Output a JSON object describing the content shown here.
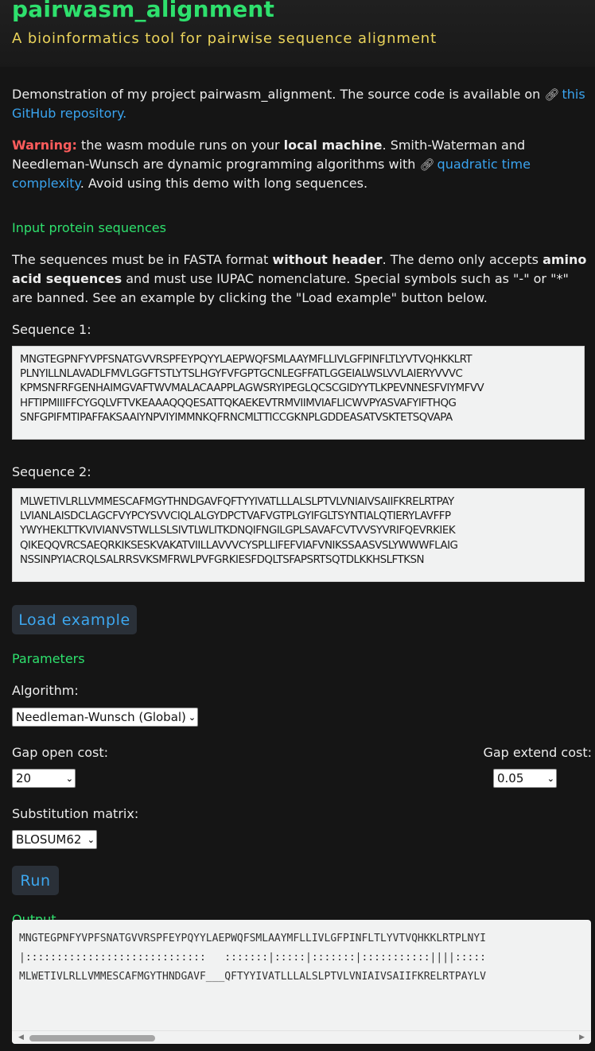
{
  "header": {
    "title": "pairwasm_alignment",
    "subtitle": "A bioinformatics tool for pairwise sequence alignment"
  },
  "intro": {
    "text": "Demonstration of my project pairwasm_alignment. The source code is available on ",
    "link_text": "this GitHub repository."
  },
  "warning": {
    "label": "Warning:",
    "text_1": " the wasm module runs on your ",
    "bold": "local machine",
    "text_2": ". Smith-Waterman and Needleman-Wunsch are dynamic programming algorithms with ",
    "link_text": "quadratic time complexity",
    "text_3": ". Avoid using this demo with long sequences."
  },
  "input_section": {
    "heading": "Input protein sequences",
    "desc_1": "The sequences must be in FASTA format ",
    "desc_bold_1": "without header",
    "desc_2": ". The demo only accepts ",
    "desc_bold_2": "amino acid sequences",
    "desc_3": " and must use IUPAC nomenclature. Special symbols such as \"-\" or \"*\" are banned. See an example by clicking the \"Load example\" button below.",
    "seq1_label": "Sequence 1:",
    "seq1_lines": [
      "MNGTEGPNFYVPFSNATGVVRSPFEYPQYYLAEPWQFSMLAAYMFLLIVLGFPINFLTLYVTVQHKKLRT",
      "PLNYILLNLAVADLFMVLGGFTSTLYTSLHGYFVFGPTGCNLEGFFATLGGEIALWSLVVLAIERYVVVC",
      "KPMSNFRFGENHAIMGVAFTWVMALACAAPPLAGWSRYIPEGLQCSCGIDYYTLKPEVNNESFVIYMFVV",
      "HFTIPMIIIFFCYGQLVFTVKEAAAQQQESATTQKAEKEVTRMVIIMVIAFLICWVPYASVAFYIFTHQG",
      "SNFGPIFMTIPAFFAKSAAIYNPVIYIMMNKQFRNCMLTTICCGKNPLGDDEASATVSKTETSQVAPA"
    ],
    "seq2_label": "Sequence 2:",
    "seq2_lines": [
      "MLWETIVLRLLVMMESCAFMGYTHNDGAVFQFTYYIVATLLLALSLPTVLVNIAIVSAIIFKRELRTPAY",
      "LVIANLAISDCLAGCFVYPCYSVVCIQLALGYDPCTVAFVGTPLGYIFGLTSYNTIALQTIERYLAVFFP",
      "YWYHEKLTTKVIVIANVSTWLLSLSIVTLWLITKDNQIFNGILGPLSAVAFCVTVVSYVRIFQEVRKIEK",
      "QIKEQQVRCSAEQRKIKSESKVAKATVIILLAVVVCYSPLLIFEFVIAFVNIKSSAASVSLYWWWFLAIG",
      "NSSINPYIACRQLSALRRSVKSMFRWLPVFGRKIESFDQLTSFAPSRTSQTDLKKHSLFTKSN"
    ],
    "load_button": "Load example"
  },
  "parameters": {
    "heading": "Parameters",
    "algorithm_label": "Algorithm:",
    "algorithm_value": "Needleman-Wunsch (Global)",
    "gap_open_label": "Gap open cost:",
    "gap_open_value": "20",
    "gap_extend_label": "Gap extend cost:",
    "gap_extend_value": "0.05",
    "matrix_label": "Substitution matrix:",
    "matrix_value": "BLOSUM62",
    "run_button": "Run"
  },
  "output": {
    "heading": "Output",
    "lines": [
      "MNGTEGPNFYVPFSNATGVVRSPFEYPQYYLAEPWQFSMLAAYMFLLIVLGFPINFLTLYVTVQHKKLRTPLNYI",
      "|:::::::::::::::::::::::::::::   :::::::|:::::|:::::::|:::::::::::||||:::::",
      "MLWETIVLRLLVMMESCAFMGYTHNDGAVF___QFTYYIVATLLLALSLPTVLVNIAIVSAIIFKRELRTPAYLV"
    ]
  },
  "colors": {
    "background": "#151515",
    "accent_green": "#2ee06d",
    "subtitle_yellow": "#ead35a",
    "link_blue": "#3aa4ef",
    "warning_red": "#ff5c5c",
    "button_bg": "#2a3038"
  },
  "icons": {
    "link": "link-icon",
    "dropdown": "chevron-down-icon"
  }
}
